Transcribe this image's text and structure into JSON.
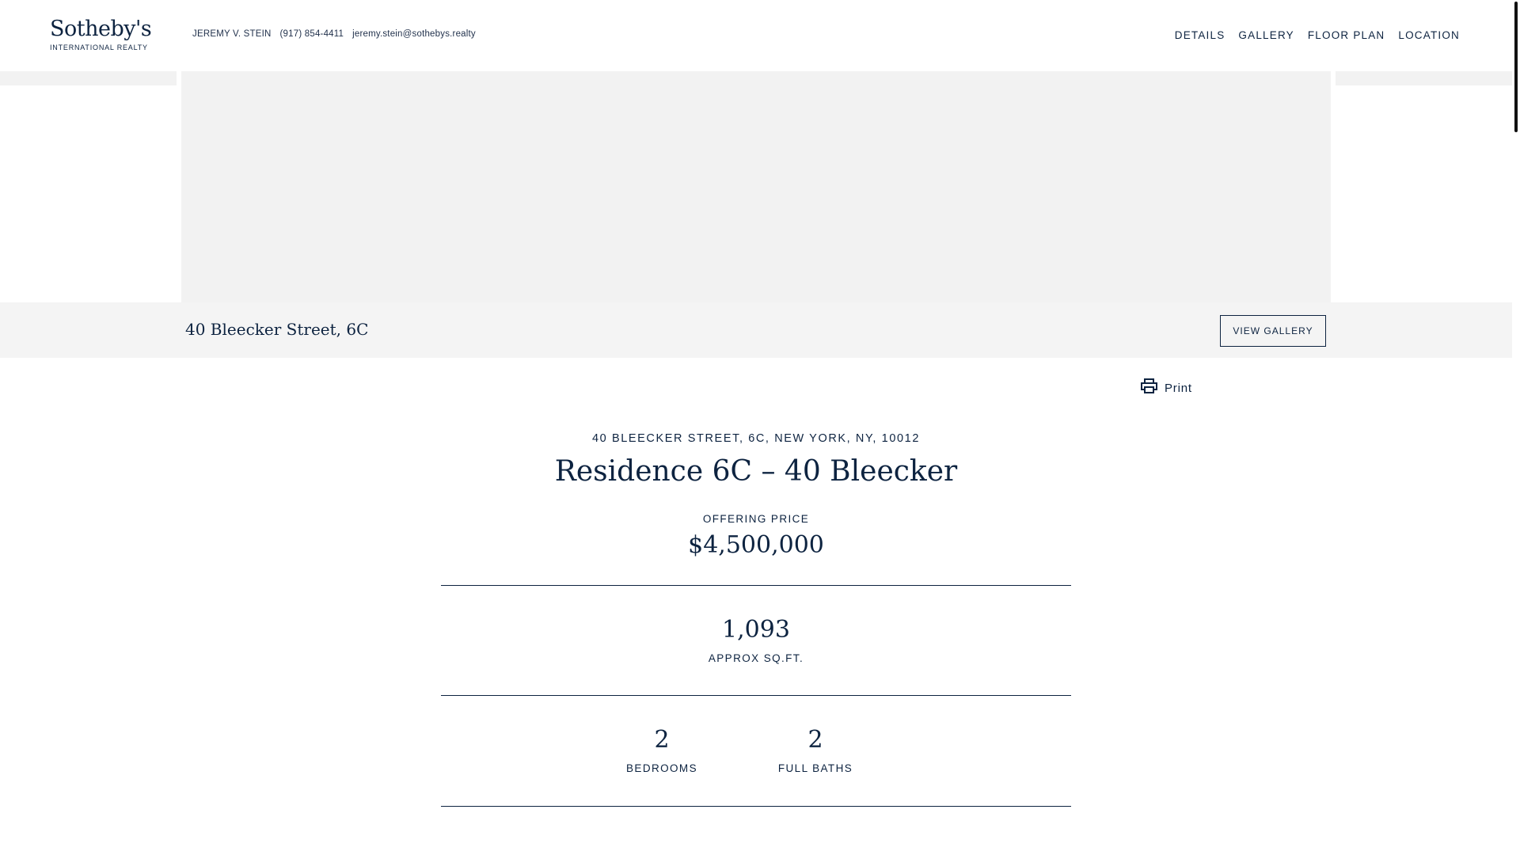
{
  "header": {
    "logo_main": "Sotheby's",
    "logo_sub": "INTERNATIONAL REALTY",
    "agent_name": "JEREMY V. STEIN",
    "agent_phone": "(917) 854-4411",
    "agent_email": "jeremy.stein@sothebys.realty",
    "nav": [
      "DETAILS",
      "GALLERY",
      "FLOOR PLAN",
      "LOCATION"
    ]
  },
  "titlebar": {
    "address": "40 Bleecker Street, 6C",
    "view_gallery": "VIEW GALLERY"
  },
  "print_label": "Print",
  "listing": {
    "full_address": "40 BLEECKER STREET, 6C, NEW YORK, NY, 10012",
    "title": "Residence 6C – 40 Bleecker",
    "price_label": "OFFERING PRICE",
    "price": "$4,500,000",
    "sqft_value": "1,093",
    "sqft_label": "APPROX SQ.FT.",
    "bedrooms_value": "2",
    "bedrooms_label": "BEDROOMS",
    "baths_value": "2",
    "baths_label": "FULL BATHS"
  },
  "colors": {
    "brand_navy": "#0d2340",
    "hero_placeholder": "#f2f2f2",
    "titlebar_bg": "#f4f4f4"
  },
  "icons": [
    "printer-icon"
  ]
}
